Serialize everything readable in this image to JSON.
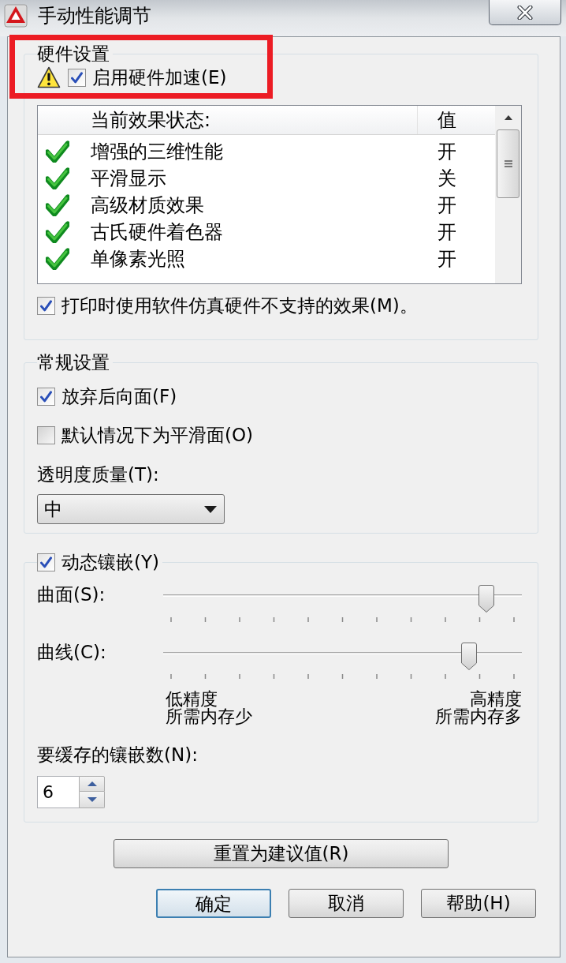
{
  "window": {
    "title": "手动性能调节"
  },
  "hardware_settings": {
    "title": "硬件设置",
    "hardware_acceleration": {
      "label": "启用硬件加速(E)",
      "checked": true
    },
    "effects": {
      "columns": [
        "当前效果状态:",
        "值"
      ],
      "rows": [
        {
          "name": "增强的三维性能",
          "value": "开",
          "supported": true
        },
        {
          "name": "平滑显示",
          "value": "关",
          "supported": true
        },
        {
          "name": "高级材质效果",
          "value": "开",
          "supported": true
        },
        {
          "name": "古氏硬件着色器",
          "value": "开",
          "supported": true
        },
        {
          "name": "单像素光照",
          "value": "开",
          "supported": true
        }
      ]
    },
    "emulate_unsupported": {
      "label": "打印时使用软件仿真硬件不支持的效果(M)。",
      "checked": true
    }
  },
  "general_settings": {
    "title": "常规设置",
    "options": [
      {
        "label": "放弃后向面(F)",
        "checked": true
      },
      {
        "label": "默认情况下为平滑面(O)",
        "checked": false
      }
    ],
    "transparency_quality": {
      "label": "透明度质量(T):",
      "value": "中"
    }
  },
  "dynamic_tessellation": {
    "label": "动态镶嵌(Y)",
    "checked": true,
    "sliders": [
      {
        "label": "曲面(S):",
        "level": 0.92
      },
      {
        "label": "曲线(C):",
        "level": 0.87
      }
    ],
    "scale_low": [
      "低精度",
      "所需内存少"
    ],
    "scale_high": [
      "高精度",
      "所需内存多"
    ],
    "cache": {
      "label": "要缓存的镶嵌数(N):",
      "value": "6"
    }
  },
  "reset_button": {
    "label": "重置为建议值(R)"
  },
  "buttons": [
    {
      "label": "确定",
      "default": true
    },
    {
      "label": "取消",
      "default": false
    },
    {
      "label": "帮助(H)",
      "default": false
    }
  ]
}
